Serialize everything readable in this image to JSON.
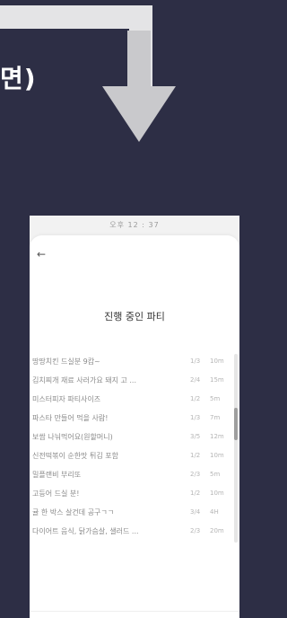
{
  "slide": {
    "heading_fragment": "면)"
  },
  "phone": {
    "status_time": "오후 12 : 37",
    "back_label": "←",
    "title": "진행 중인 파티",
    "parties": [
      {
        "name": "땅땅치킨 드실분 9캄~",
        "count": "1/3",
        "time": "10m"
      },
      {
        "name": "김치찌개 재료 사러가요 돼지 고 ...",
        "count": "2/4",
        "time": "15m"
      },
      {
        "name": "미스터피자 파티사이즈",
        "count": "1/2",
        "time": "5m"
      },
      {
        "name": "파스타 만들어 먹을 사람!",
        "count": "1/3",
        "time": "7m"
      },
      {
        "name": "보쌈 나눠먹어요(원할머니)",
        "count": "3/5",
        "time": "12m"
      },
      {
        "name": "신전떡볶이 순한맛 튀김 포함",
        "count": "1/2",
        "time": "10m"
      },
      {
        "name": "밀플랜비 부리또",
        "count": "2/3",
        "time": "5m"
      },
      {
        "name": "고등어 드실 분!",
        "count": "1/2",
        "time": "10m"
      },
      {
        "name": "귤 한 박스 살건데 공구ㄱㄱ",
        "count": "3/4",
        "time": "4H"
      },
      {
        "name": "다이어트 음식, 닭가슴살, 샐러드 ...",
        "count": "2/3",
        "time": "20m"
      }
    ]
  }
}
